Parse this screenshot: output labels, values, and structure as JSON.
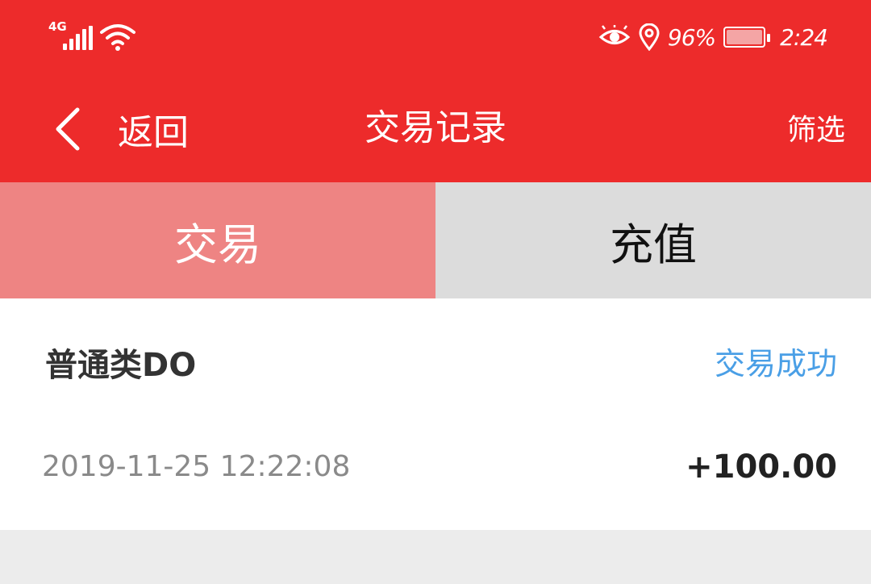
{
  "status_bar": {
    "network": "4G",
    "battery_percent": "96%",
    "time": "2:24",
    "icons": [
      "signal-icon",
      "wifi-icon",
      "eye-icon",
      "location-icon",
      "battery-icon"
    ]
  },
  "navbar": {
    "back_label": "返回",
    "title": "交易记录",
    "filter_label": "筛选"
  },
  "tabs": [
    {
      "label": "交易",
      "active": true
    },
    {
      "label": "充值",
      "active": false
    }
  ],
  "records": [
    {
      "name": "普通类DO",
      "status": "交易成功",
      "time": "2019-11-25 12:22:08",
      "amount": "+100.00"
    }
  ],
  "colors": {
    "header_red": "#ed2b2b",
    "active_tab": "#ee8483",
    "inactive_tab": "#dcdcdc",
    "status_blue": "#4a9fe6",
    "page_bg": "#ececec"
  }
}
